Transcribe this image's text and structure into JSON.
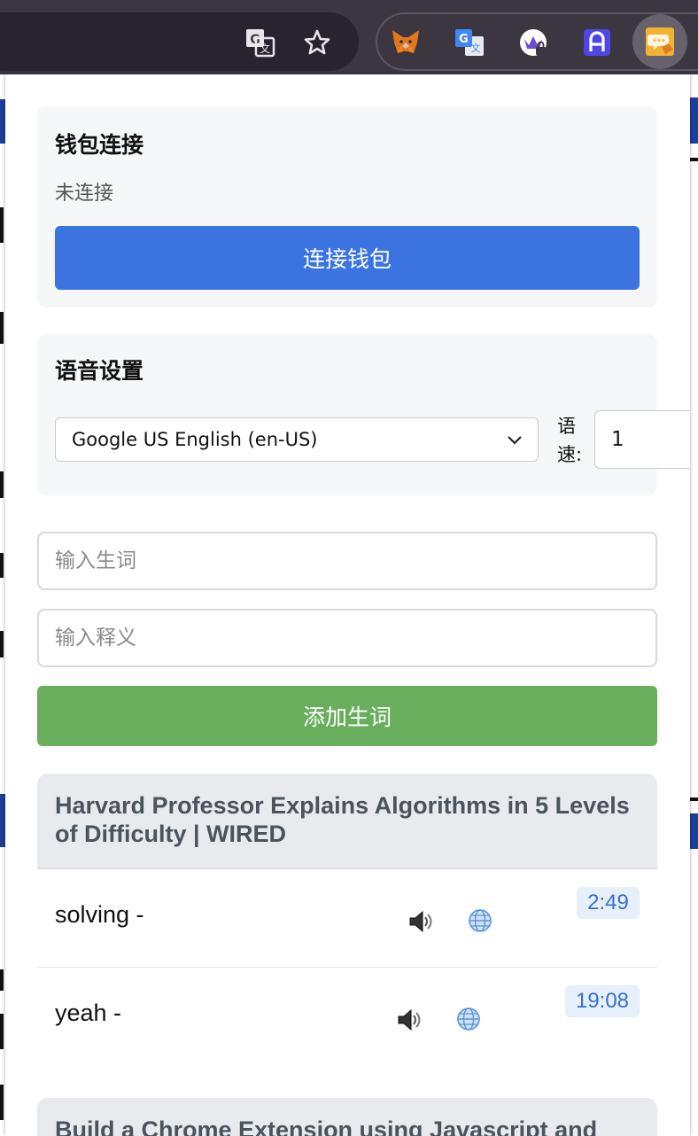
{
  "toolbar": {
    "icons": [
      "translate-page-icon",
      "bookmark-star-icon",
      "metamask-fox-icon",
      "google-translate-icon",
      "vpn-lock-icon",
      "a-letter-icon",
      "chat-extension-icon"
    ]
  },
  "wallet": {
    "title": "钱包连接",
    "status": "未连接",
    "connect_label": "连接钱包"
  },
  "voice": {
    "title": "语音设置",
    "selected_voice": "Google US English (en-US)",
    "rate_label": "语速:",
    "rate_value": "1"
  },
  "form": {
    "word_placeholder": "输入生词",
    "meaning_placeholder": "输入释义",
    "add_label": "添加生词"
  },
  "videos": [
    {
      "title": "Harvard Professor Explains Algorithms in 5 Levels of Difficulty | WIRED",
      "words": [
        {
          "text": "solving -",
          "time": "2:49"
        },
        {
          "text": "yeah -",
          "time": "19:08"
        }
      ]
    },
    {
      "title": "Build a Chrome Extension using Javascript and"
    }
  ],
  "colors": {
    "connect_button": "#3b74e0",
    "add_button": "#68ae5c",
    "time_badge_bg": "#e6effa",
    "time_badge_text": "#3a6fc9"
  }
}
